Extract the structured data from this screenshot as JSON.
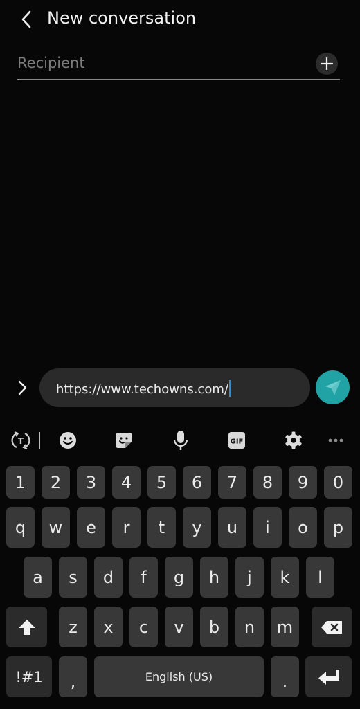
{
  "header": {
    "title": "New conversation",
    "back_icon": "chevron-left-icon"
  },
  "recipient": {
    "placeholder": "Recipient",
    "value": "",
    "add_icon": "plus-icon"
  },
  "compose": {
    "expand_icon": "chevron-right-icon",
    "message_text": "https://www.techowns.com/",
    "send_icon": "send-icon",
    "accent_color": "#21a3a6",
    "caret_color": "#2a8fd6"
  },
  "keyboard_toolbar": {
    "items": [
      {
        "name": "translate",
        "icon": "translate-icon"
      },
      {
        "name": "emoji",
        "icon": "emoji-icon"
      },
      {
        "name": "sticker",
        "icon": "sticker-icon"
      },
      {
        "name": "voice",
        "icon": "microphone-icon"
      },
      {
        "name": "gif",
        "icon": "gif-icon",
        "label": "GIF"
      },
      {
        "name": "settings",
        "icon": "gear-icon"
      },
      {
        "name": "more",
        "icon": "more-horizontal-icon"
      }
    ]
  },
  "keyboard": {
    "number_row": [
      "1",
      "2",
      "3",
      "4",
      "5",
      "6",
      "7",
      "8",
      "9",
      "0"
    ],
    "row1": [
      "q",
      "w",
      "e",
      "r",
      "t",
      "y",
      "u",
      "i",
      "o",
      "p"
    ],
    "row2": [
      "a",
      "s",
      "d",
      "f",
      "g",
      "h",
      "j",
      "k",
      "l"
    ],
    "row3": [
      "z",
      "x",
      "c",
      "v",
      "b",
      "n",
      "m"
    ],
    "shift_icon": "shift-icon",
    "backspace_icon": "backspace-icon",
    "symbols_label": "!#1",
    "comma_label": ",",
    "space_label": "English (US)",
    "period_label": ".",
    "enter_icon": "enter-icon"
  }
}
